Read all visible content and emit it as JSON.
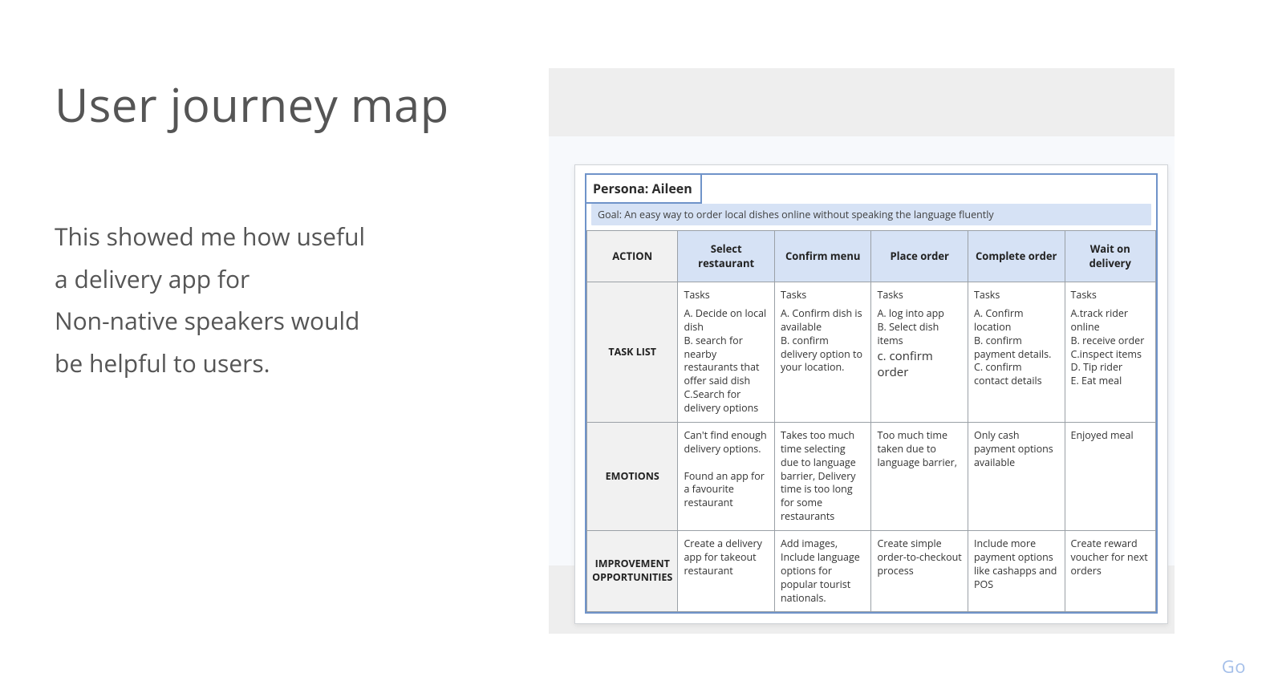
{
  "title": "User journey map",
  "body_lines": [
    "This showed me how useful",
    "a delivery app for",
    "Non-native speakers would",
    "be helpful to users."
  ],
  "persona_label": "Persona: Aileen",
  "goal_text": "Goal: An easy way to order local dishes online without speaking the language fluently",
  "columns": {
    "action": "ACTION",
    "c1": "Select restaurant",
    "c2": "Confirm menu",
    "c3": "Place order",
    "c4": "Complete order",
    "c5": "Wait on delivery"
  },
  "rows": {
    "task_list": {
      "label": "TASK LIST",
      "tasks_label": "Tasks",
      "c1": "A. Decide on local dish\nB. search for nearby restaurants that offer said dish\nC.Search for delivery options",
      "c2": "A. Confirm dish is available\nB. confirm delivery option to your location.",
      "c3_a": "A. log into app",
      "c3_b": "B. Select dish items",
      "c3_c": "c. confirm order",
      "c4": "A. Confirm location\nB. confirm payment details.\nC. confirm contact details",
      "c5": "A.track rider online\nB. receive order\nC.inspect items\nD. Tip rider\nE. Eat meal"
    },
    "emotions": {
      "label": "EMOTIONS",
      "c1": "Can't find enough delivery options.\n\nFound an app for a favourite restaurant",
      "c2": "Takes too much time selecting due to language barrier, Delivery time is too long for some restaurants",
      "c3": "Too much time taken due to language barrier,",
      "c4": "Only cash payment options available",
      "c5": "Enjoyed meal"
    },
    "improvement": {
      "label": "IMPROVEMENT OPPORTUNITIES",
      "c1": "Create a delivery app for takeout restaurant",
      "c2": "Add images, Include language options for popular tourist nationals.",
      "c3": "Create simple order-to-checkout process",
      "c4": "Include more payment options like cashapps and POS",
      "c5": "Create reward voucher for next orders"
    }
  },
  "footer": "Go"
}
